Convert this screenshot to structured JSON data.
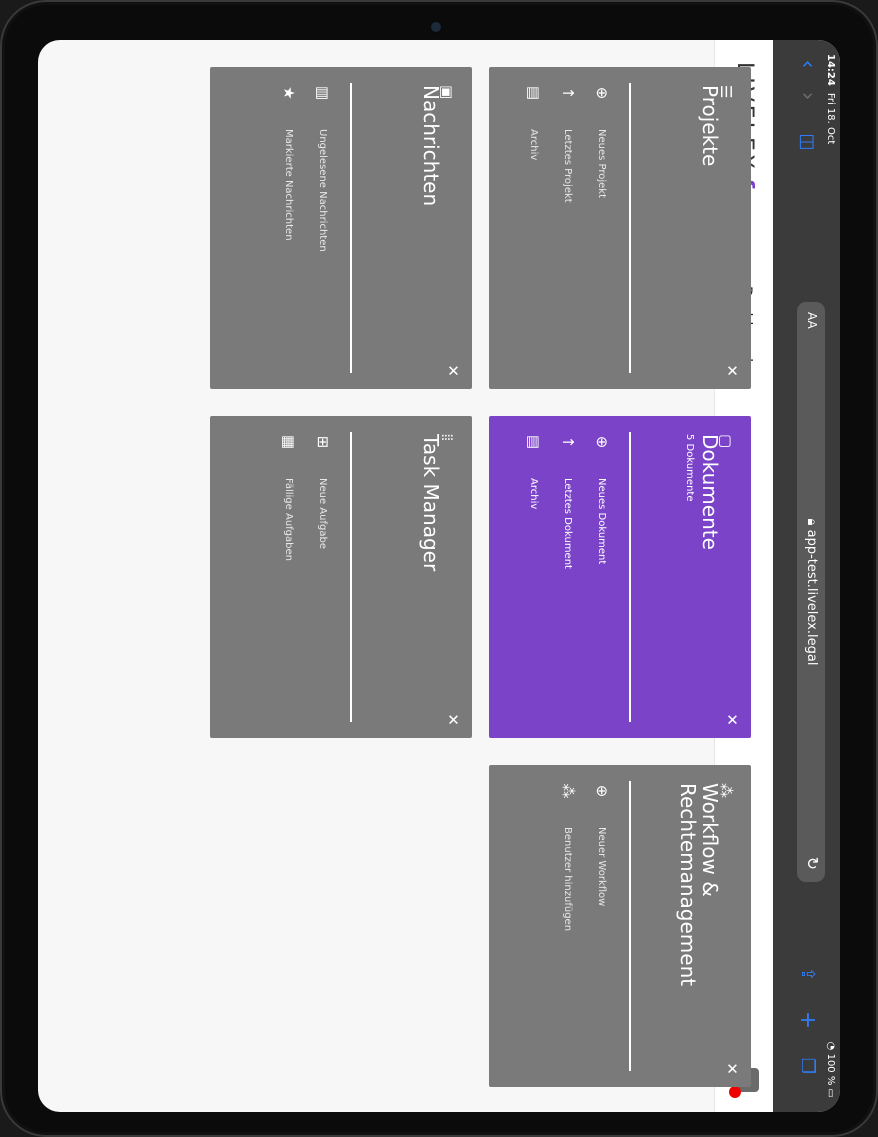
{
  "status": {
    "time": "14:24",
    "date": "Fri 18. Oct",
    "battery": "100 %"
  },
  "browser": {
    "aa_label": "AA",
    "url": "app-test.livelex.legal",
    "icons": {
      "back": "chevron-up-icon",
      "forward": "chevron-down-icon",
      "bookmarks": "book-icon",
      "reload": "reload-icon",
      "share": "share-icon",
      "new_tab": "plus-icon",
      "tabs": "tabs-icon"
    }
  },
  "app": {
    "logo": "LIVELEX",
    "nav": {
      "dashboard": "Dashboard"
    },
    "accent": "#7b44c8",
    "card_color": "#7a7a7a"
  },
  "cards": {
    "projekte": {
      "title": "Projekte",
      "items": [
        "Neues Projekt",
        "Letztes Projekt",
        "Archiv"
      ]
    },
    "dokumente": {
      "title": "Dokumente",
      "subtitle": "5 Dokumente",
      "items": [
        "Neues Dokument",
        "Letztes Dokument",
        "Archiv"
      ]
    },
    "workflow": {
      "title_line1": "Workflow &",
      "title_line2": "Rechtemanagement",
      "items": [
        "Neuer Workflow",
        "Benutzer hinzufügen"
      ]
    },
    "nachrichten": {
      "title": "Nachrichten",
      "items": [
        "Ungelesene Nachrichten",
        "Markierte Nachrichten"
      ]
    },
    "taskmanager": {
      "title": "Task Manager",
      "items": [
        "Neue Aufgabe",
        "Fällige Aufgaben"
      ]
    }
  }
}
